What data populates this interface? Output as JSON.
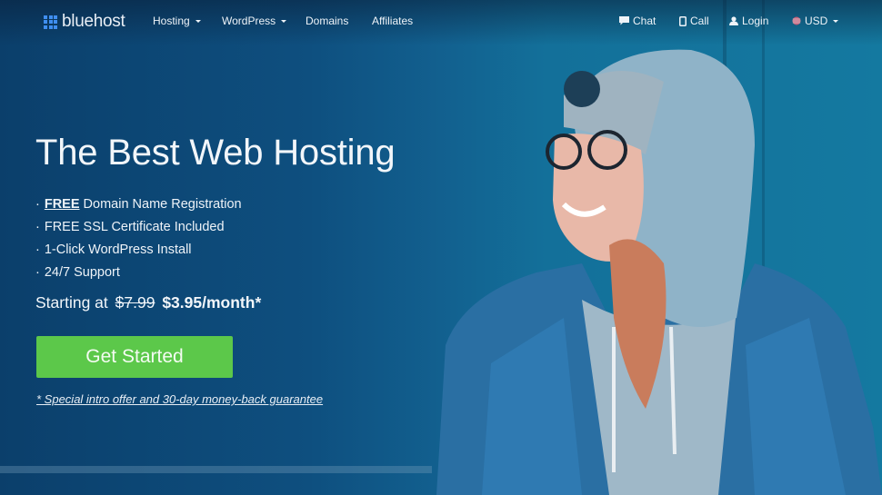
{
  "brand": {
    "name": "bluehost",
    "logo_icon": "grid-icon",
    "accent_color": "#3f8ef0"
  },
  "nav": {
    "left_items": [
      {
        "label": "Hosting",
        "has_dropdown": true
      },
      {
        "label": "WordPress",
        "has_dropdown": true
      },
      {
        "label": "Domains",
        "has_dropdown": false
      },
      {
        "label": "Affiliates",
        "has_dropdown": false
      }
    ],
    "right_items": [
      {
        "label": "Chat",
        "icon": "chat-icon"
      },
      {
        "label": "Call",
        "icon": "phone-icon"
      },
      {
        "label": "Login",
        "icon": "user-icon"
      },
      {
        "label": "USD",
        "icon": "flag-icon",
        "has_dropdown": true
      }
    ]
  },
  "hero": {
    "headline": "The Best Web Hosting",
    "features": [
      {
        "bullet": "·",
        "emph": "FREE",
        "text": " Domain Name Registration"
      },
      {
        "bullet": "·",
        "emph": "",
        "text": "FREE SSL Certificate Included"
      },
      {
        "bullet": "·",
        "emph": "",
        "text": "1-Click WordPress Install"
      },
      {
        "bullet": "·",
        "emph": "",
        "text": "24/7 Support"
      }
    ],
    "price": {
      "prefix": "Starting at",
      "old_price": "$7.99",
      "new_price": "$3.95/month*"
    },
    "cta_label": "Get Started",
    "cta_color": "#5cc84a",
    "offer_link": "* Special intro offer and 30-day money-back guarantee"
  }
}
